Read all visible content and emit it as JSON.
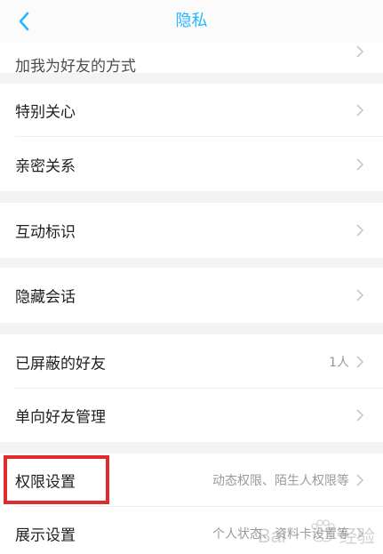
{
  "nav": {
    "back_icon": "chevron-left-icon",
    "title": "隐私"
  },
  "rows": {
    "add_me_way": {
      "label": "加我为好友的方式"
    },
    "special_care": {
      "label": "特别关心"
    },
    "close_relation": {
      "label": "亲密关系"
    },
    "interaction_marks": {
      "label": "互动标识"
    },
    "hidden_chats": {
      "label": "隐藏会话"
    },
    "blocked_friends": {
      "label": "已屏蔽的好友",
      "value": "1人"
    },
    "one_way_friends": {
      "label": "单向好友管理"
    },
    "permission_settings": {
      "label": "权限设置",
      "value": "动态权限、陌生人权限等"
    },
    "display_settings": {
      "label": "展示设置",
      "value": "个人状态、资料卡设置等"
    }
  },
  "colors": {
    "accent": "#27b7ff",
    "highlight_border": "#e12a2a",
    "background": "#f2f3f5",
    "row": "#ffffff"
  }
}
